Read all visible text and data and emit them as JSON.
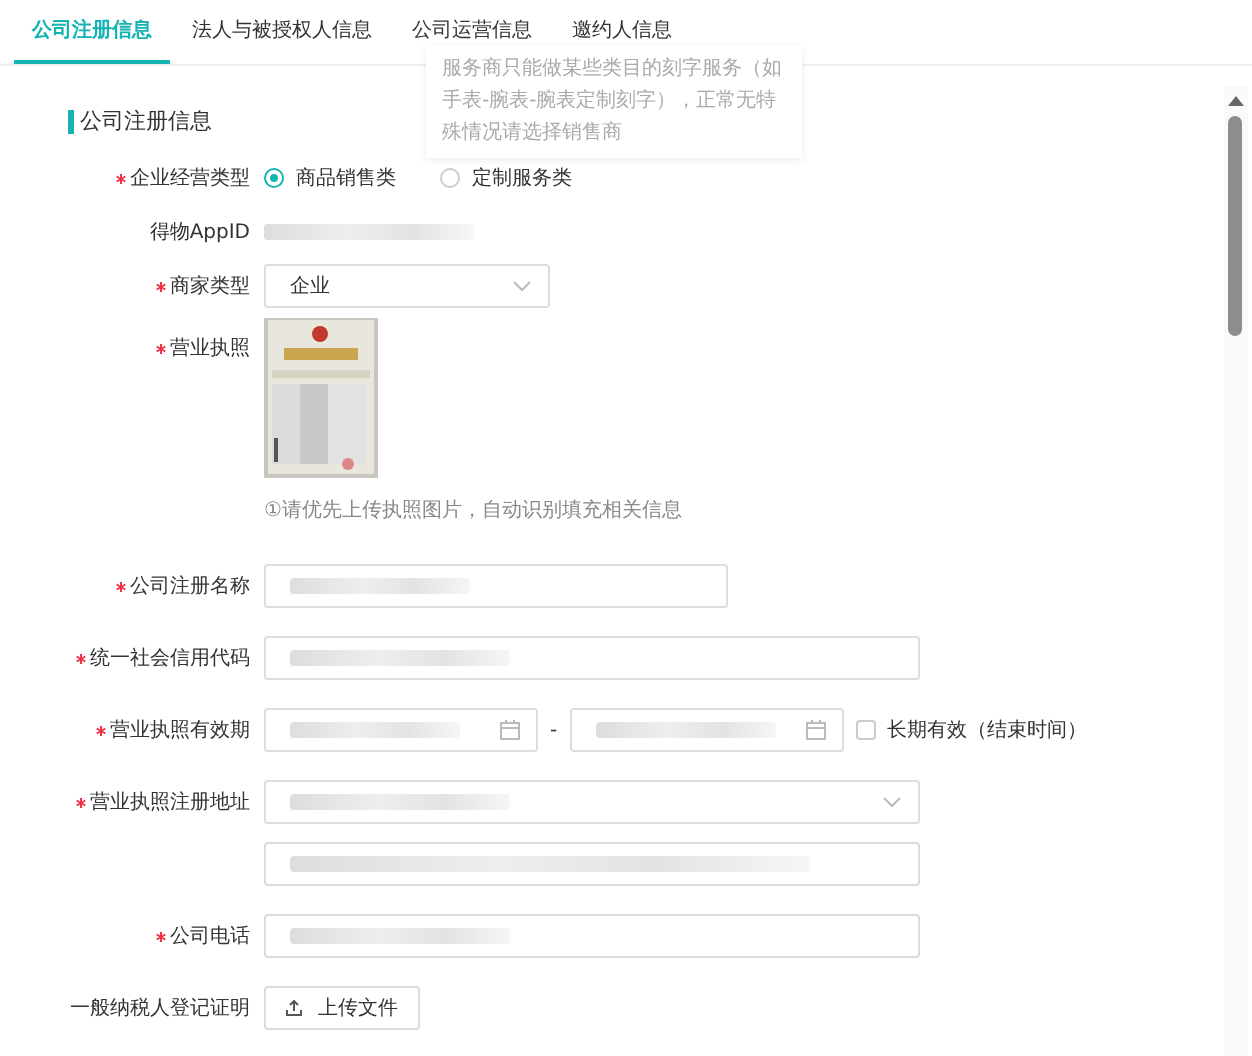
{
  "tabs": [
    {
      "label": "公司注册信息",
      "selected": true
    },
    {
      "label": "法人与被授权人信息",
      "selected": false
    },
    {
      "label": "公司运营信息",
      "selected": false
    },
    {
      "label": "邀约人信息",
      "selected": false
    }
  ],
  "tooltip": {
    "text": "服务商只能做某些类目的刻字服务（如手表-腕表-腕表定制刻字），正常无特殊情况请选择销售商"
  },
  "section": {
    "title": "公司注册信息"
  },
  "fields": [
    {
      "kind": "radio",
      "label": "企业经营类型",
      "required": true,
      "options": [
        {
          "label": "商品销售类",
          "selected": true
        },
        {
          "label": "定制服务类",
          "selected": false
        }
      ]
    },
    {
      "kind": "readonly",
      "label": "得物AppID",
      "required": false,
      "redacted": true
    },
    {
      "kind": "select",
      "label": "商家类型",
      "required": true,
      "value": "企业"
    },
    {
      "label": "营业执照",
      "required": true,
      "hint": "①请优先上传执照图片，自动识别填充相关信息"
    },
    {
      "kind": "short_input",
      "label": "公司注册名称",
      "required": true,
      "redacted": true
    },
    {
      "kind": "input",
      "label": "统一社会信用代码",
      "required": true,
      "redacted": true
    },
    {
      "kind": "date_range",
      "label": "营业执照有效期",
      "required": true,
      "redacted": true,
      "separator": "-",
      "checkbox": {
        "label": "长期有效（结束时间）",
        "checked": false
      }
    },
    {
      "kind": "address",
      "label": "营业执照注册地址",
      "required": true,
      "redacted": true
    },
    {
      "kind": "input",
      "label": "公司电话",
      "required": true,
      "redacted": true
    },
    {
      "kind": "upload",
      "label": "一般纳税人登记证明",
      "required": false,
      "button": "上传文件"
    }
  ]
}
